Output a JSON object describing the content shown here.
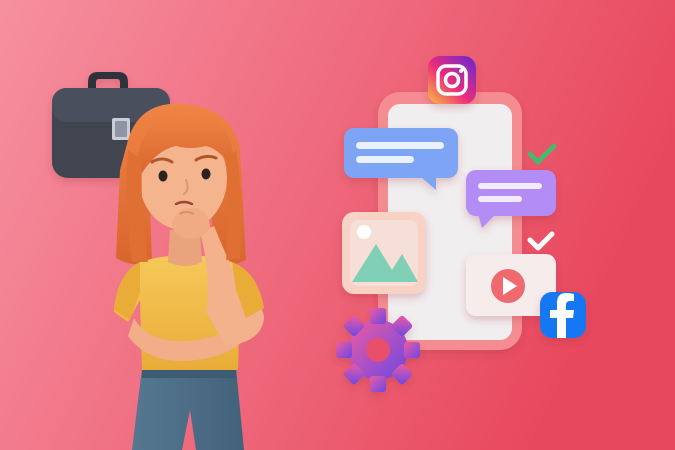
{
  "scene": {
    "background": {
      "from": "#f58595",
      "to": "#e84a60"
    },
    "character": {
      "hair": "#e8763a",
      "skin": "#f4b48e",
      "shirt": "#f2bd4a",
      "jeans": "#4d6f86"
    },
    "briefcase": {
      "body": "#3f4450",
      "clasp": "#c9ced6"
    },
    "phone": {
      "frame": "#f48c92",
      "screen": "#f1eef0"
    },
    "icons": [
      {
        "name": "instagram-icon",
        "colors": [
          "#f9c23c",
          "#ee2a7b",
          "#6228d7"
        ]
      },
      {
        "name": "facebook-icon",
        "color": "#1877f2"
      },
      {
        "name": "gear-icon",
        "colors": [
          "#ef5ca4",
          "#7b4be8"
        ]
      },
      {
        "name": "checkmark-icon",
        "color": "#49b86a"
      },
      {
        "name": "checkmark-icon",
        "color": "#ffffff"
      },
      {
        "name": "play-icon",
        "color": "#ee6a6e"
      },
      {
        "name": "image-icon",
        "color": "#7fd0b6"
      }
    ],
    "bubbles": [
      {
        "name": "chat-bubble-blue",
        "color": "#7ea4f6"
      },
      {
        "name": "chat-bubble-purple",
        "color": "#b48cf6"
      }
    ]
  }
}
